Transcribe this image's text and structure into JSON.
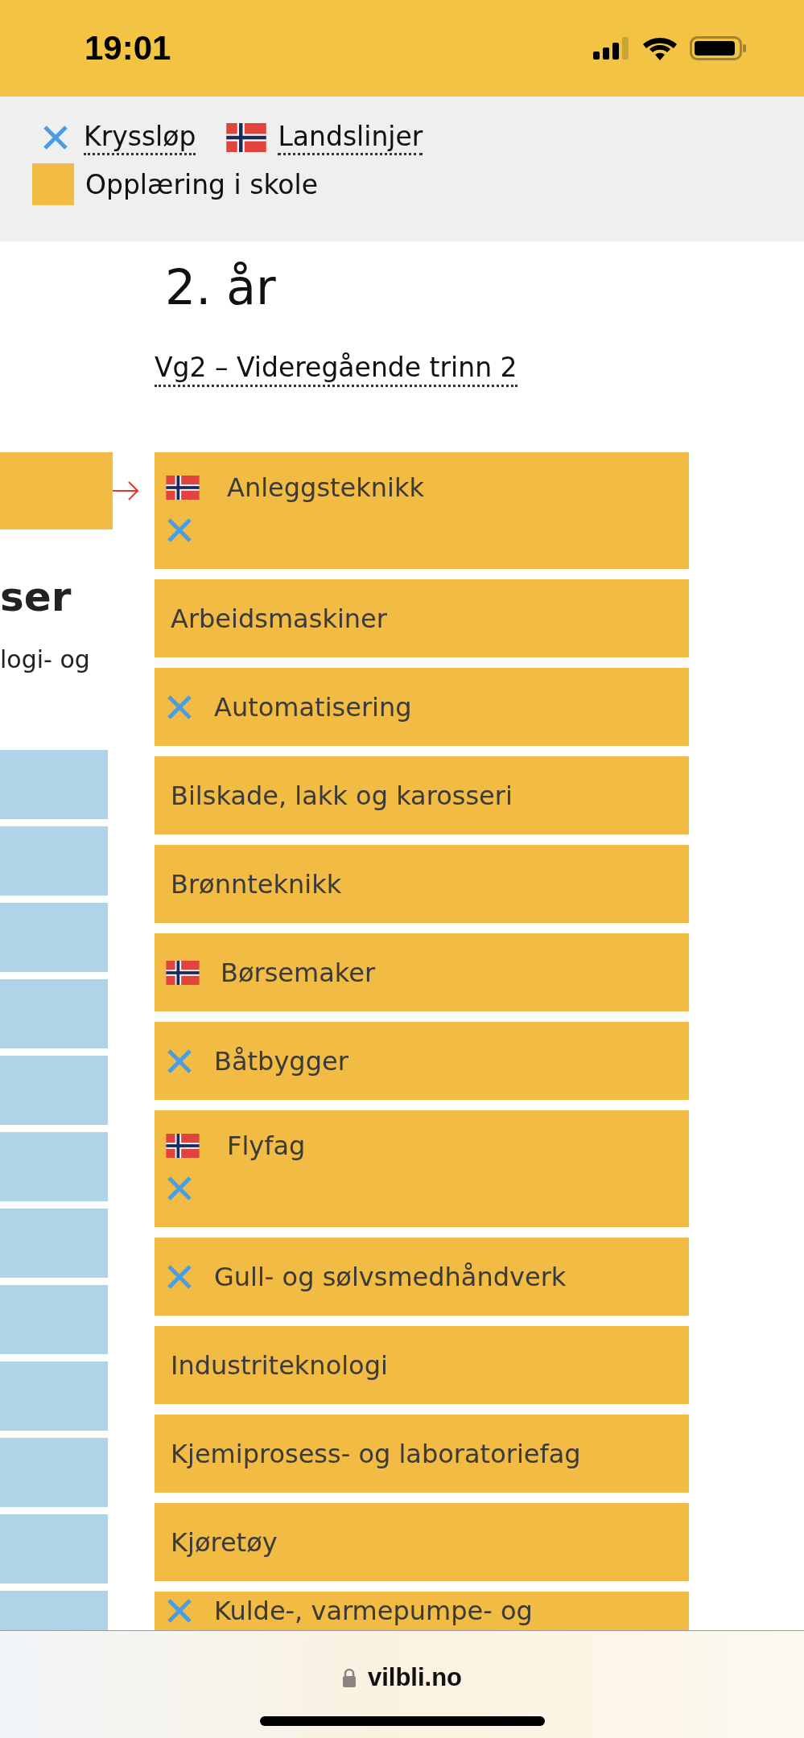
{
  "status_bar": {
    "time": "19:01"
  },
  "legend": [
    {
      "kind": "cross",
      "label": "Kryssløp"
    },
    {
      "kind": "flag",
      "label": "Landslinjer"
    },
    {
      "kind": "swatch",
      "label": "Opplæring i skole",
      "color": "#f2bb44"
    }
  ],
  "left_column": {
    "heading": "ser",
    "text": "logi- og"
  },
  "year": {
    "heading": "2. år",
    "link": "Vg2 – Videregående trinn 2"
  },
  "programs": [
    {
      "label": "Anleggsteknikk",
      "national": true,
      "cross": true
    },
    {
      "label": "Arbeidsmaskiner",
      "national": false,
      "cross": false
    },
    {
      "label": "Automatisering",
      "national": false,
      "cross": true
    },
    {
      "label": "Bilskade, lakk og karosseri",
      "national": false,
      "cross": false
    },
    {
      "label": "Brønnteknikk",
      "national": false,
      "cross": false
    },
    {
      "label": "Børsemaker",
      "national": true,
      "cross": false
    },
    {
      "label": "Båtbygger",
      "national": false,
      "cross": true
    },
    {
      "label": "Flyfag",
      "national": true,
      "cross": true
    },
    {
      "label": "Gull- og sølvsmedhåndverk",
      "national": false,
      "cross": true
    },
    {
      "label": "Industriteknologi",
      "national": false,
      "cross": false
    },
    {
      "label": "Kjemiprosess- og laboratoriefag",
      "national": false,
      "cross": false
    },
    {
      "label": "Kjøretøy",
      "national": false,
      "cross": false
    },
    {
      "label": "Kulde-, varmepumpe- og",
      "national": false,
      "cross": true
    }
  ],
  "address_bar": {
    "url": "vilbli.no"
  }
}
